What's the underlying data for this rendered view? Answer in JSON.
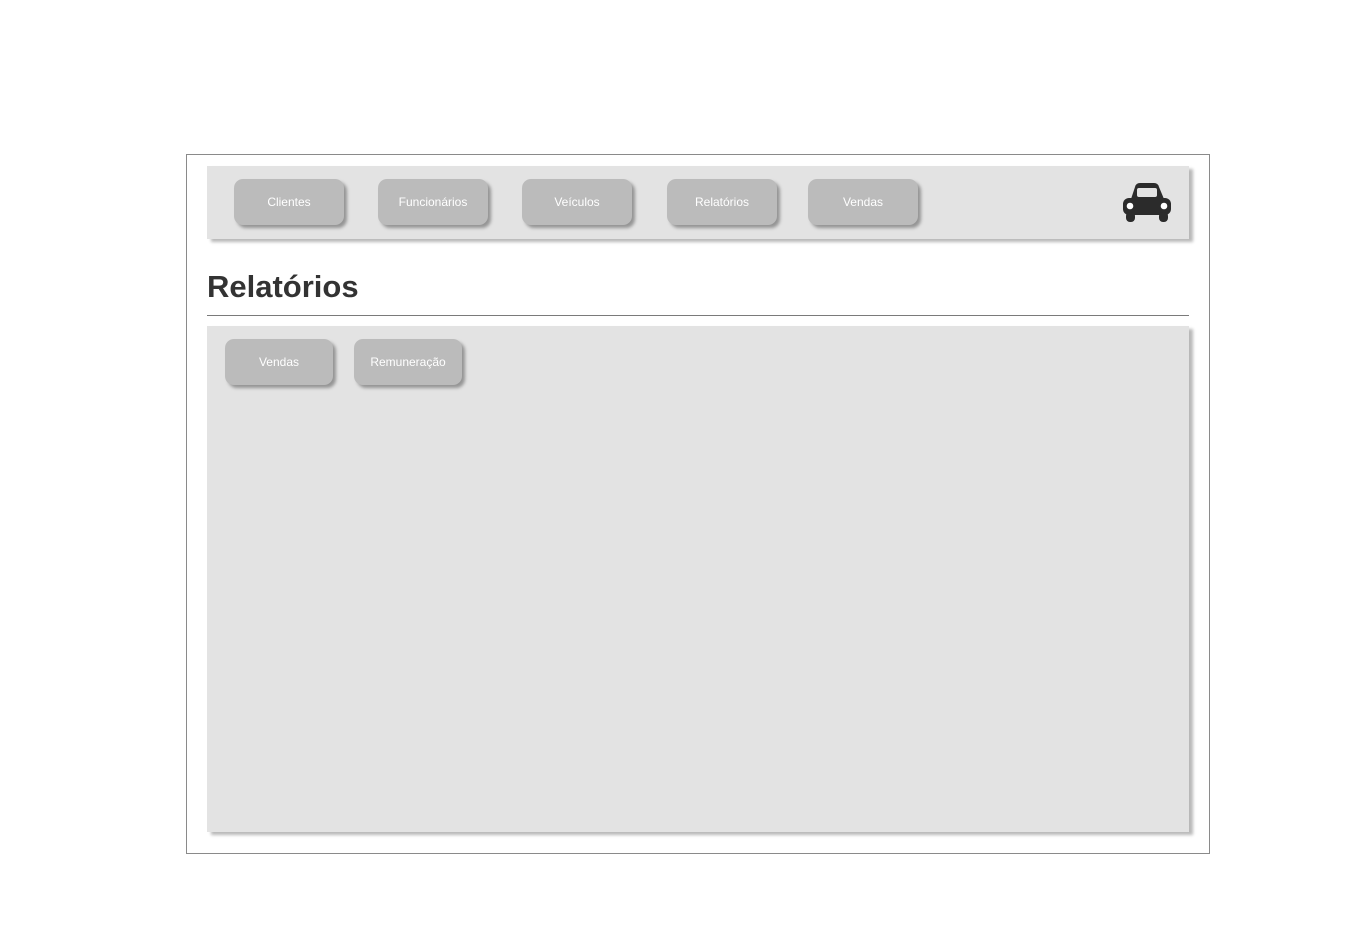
{
  "nav": {
    "items": [
      {
        "label": "Clientes"
      },
      {
        "label": "Funcionários"
      },
      {
        "label": "Veículos"
      },
      {
        "label": "Relatórios"
      },
      {
        "label": "Vendas"
      }
    ],
    "logo_icon": "car-icon"
  },
  "page": {
    "title": "Relatórios"
  },
  "reports": {
    "buttons": [
      {
        "label": "Vendas"
      },
      {
        "label": "Remuneração"
      }
    ]
  },
  "colors": {
    "button_bg": "#bbbbbb",
    "panel_bg": "#e3e3e3",
    "title_text": "#333333",
    "icon": "#2b2b2b"
  }
}
